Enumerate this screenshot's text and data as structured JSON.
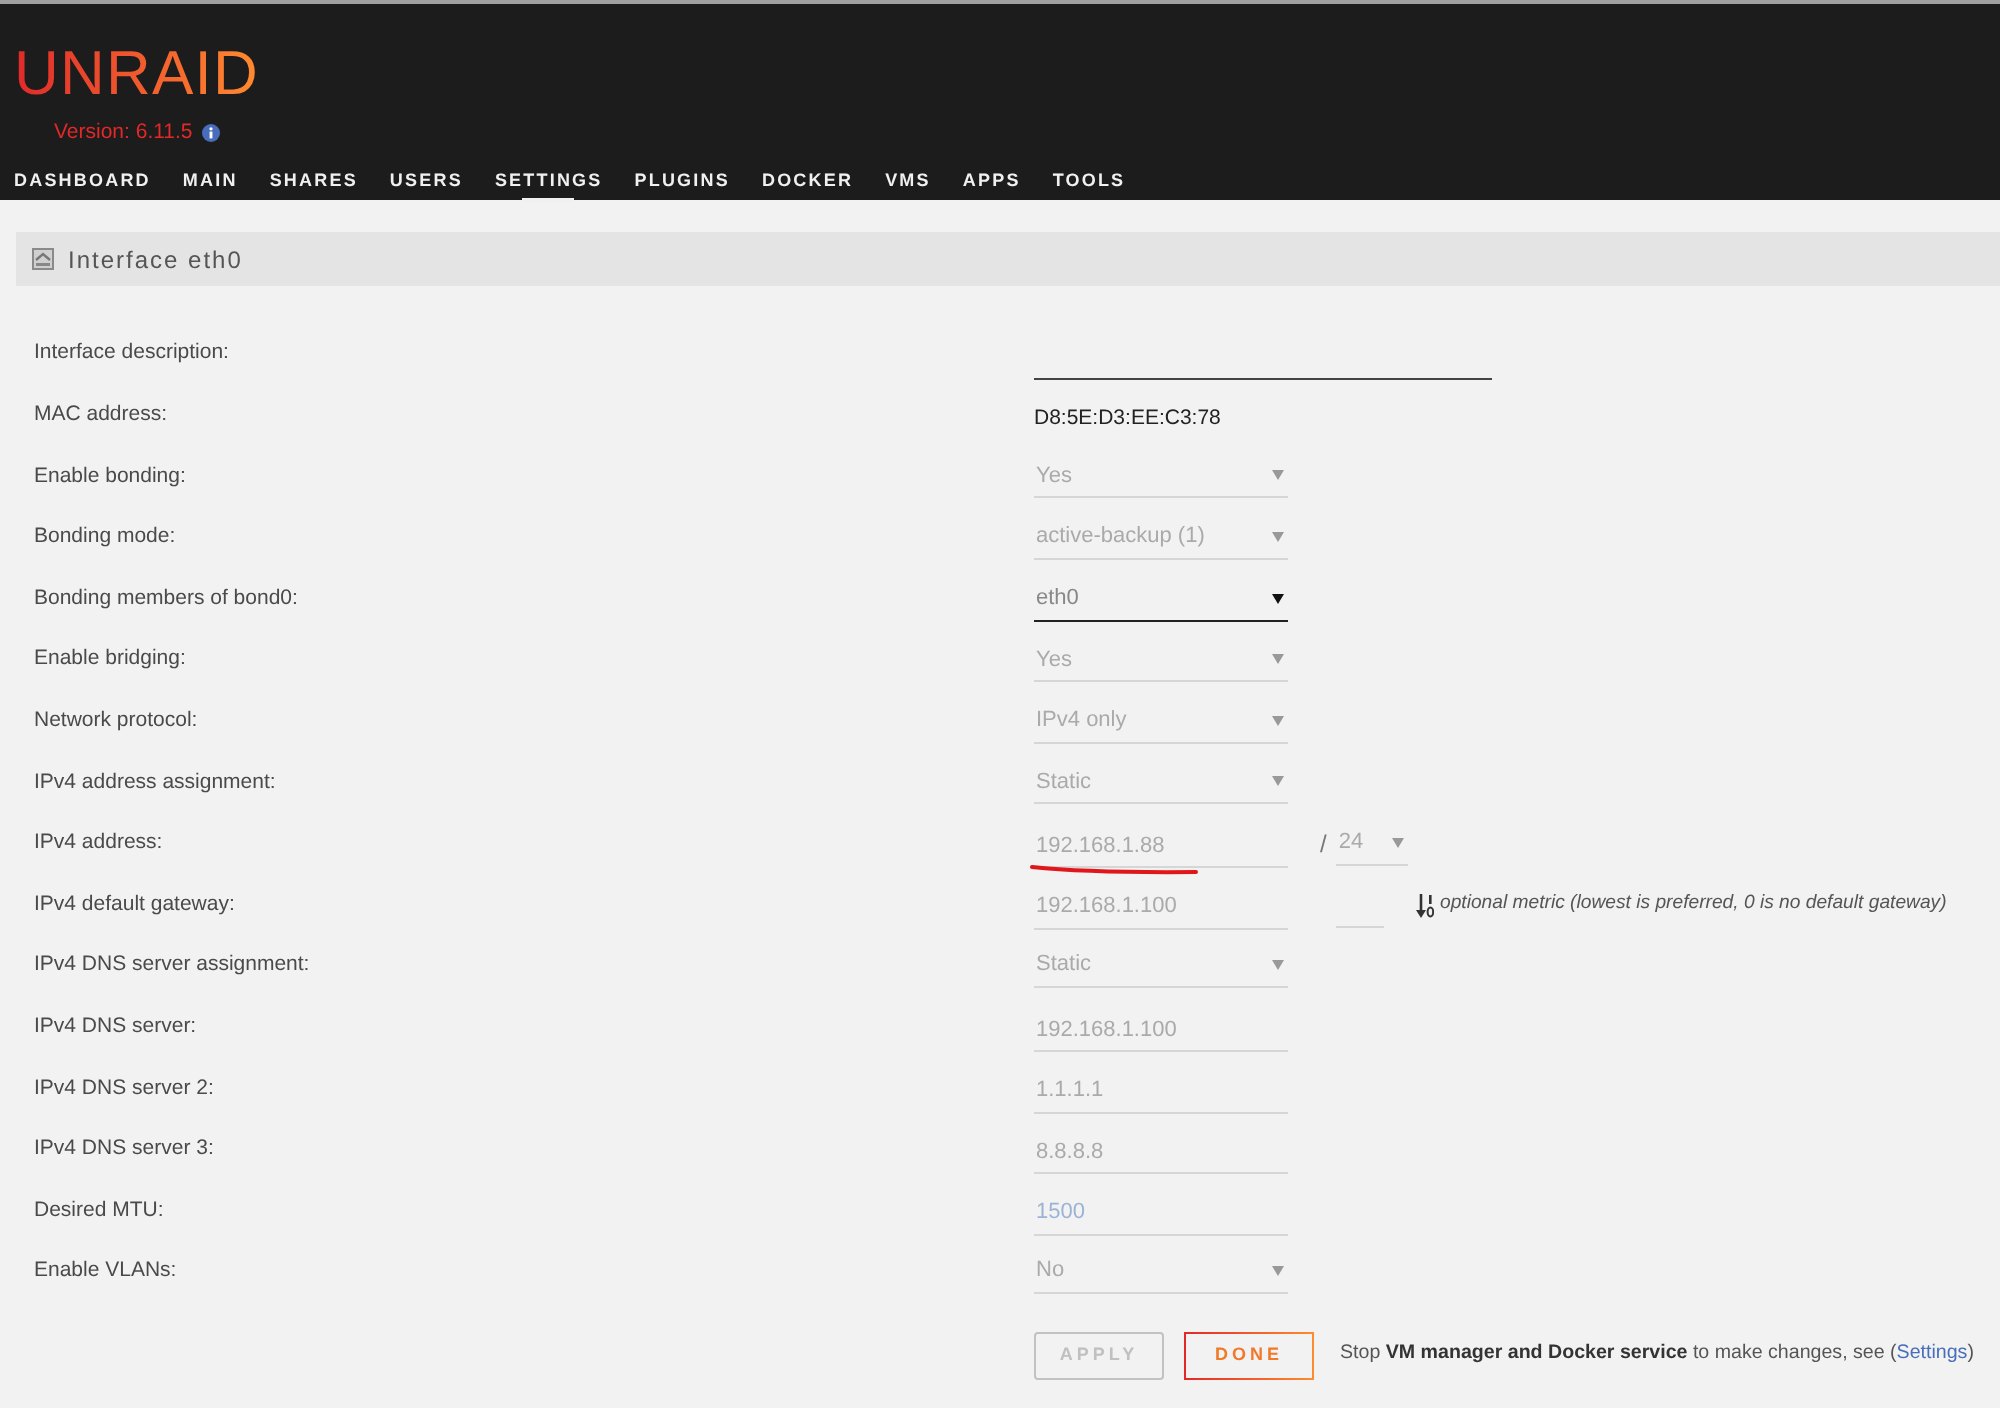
{
  "header": {
    "logo": "UNRAID",
    "version": "Version: 6.11.5",
    "nav": [
      {
        "label": "DASHBOARD",
        "selected": false
      },
      {
        "label": "MAIN",
        "selected": false
      },
      {
        "label": "SHARES",
        "selected": false
      },
      {
        "label": "USERS",
        "selected": false
      },
      {
        "label": "SETTINGS",
        "selected": true
      },
      {
        "label": "PLUGINS",
        "selected": false
      },
      {
        "label": "DOCKER",
        "selected": false
      },
      {
        "label": "VMS",
        "selected": false
      },
      {
        "label": "APPS",
        "selected": false
      },
      {
        "label": "TOOLS",
        "selected": false
      }
    ]
  },
  "panel": {
    "title": "Interface eth0"
  },
  "fields": [
    {
      "label": "Interface description:",
      "kind": "textline",
      "disabled": false
    },
    {
      "label": "MAC address:",
      "kind": "static",
      "value": "D8:5E:D3:EE:C3:78"
    },
    {
      "label": "Enable bonding:",
      "kind": "select",
      "value": "Yes",
      "disabled": true
    },
    {
      "label": "Bonding mode:",
      "kind": "select",
      "value": "active-backup (1)",
      "disabled": true
    },
    {
      "label": "Bonding members of bond0:",
      "kind": "select",
      "value": "eth0",
      "disabled": false
    },
    {
      "label": "Enable bridging:",
      "kind": "select",
      "value": "Yes",
      "disabled": true
    },
    {
      "label": "Network protocol:",
      "kind": "select",
      "value": "IPv4 only",
      "disabled": true
    },
    {
      "label": "IPv4 address assignment:",
      "kind": "select",
      "value": "Static",
      "disabled": true
    },
    {
      "label": "IPv4 address:",
      "kind": "input",
      "value": "192.168.1.88",
      "disabled": true,
      "marked": true,
      "suffix": {
        "separator": "/",
        "value": "24",
        "disabled": true
      }
    },
    {
      "label": "IPv4 default gateway:",
      "kind": "input",
      "value": "192.168.1.100",
      "disabled": true,
      "metric": {
        "disabled": true,
        "note": "optional metric (lowest is preferred, 0 is no default gateway)"
      }
    },
    {
      "label": "IPv4 DNS server assignment:",
      "kind": "select",
      "value": "Static",
      "disabled": true
    },
    {
      "label": "IPv4 DNS server:",
      "kind": "input",
      "value": "192.168.1.100",
      "disabled": true
    },
    {
      "label": "IPv4 DNS server 2:",
      "kind": "input",
      "value": "1.1.1.1",
      "disabled": true
    },
    {
      "label": "IPv4 DNS server 3:",
      "kind": "input",
      "value": "8.8.8.8",
      "disabled": true
    },
    {
      "label": "Desired MTU:",
      "kind": "input",
      "placeholder": "1500",
      "disabled": true
    },
    {
      "label": "Enable VLANs:",
      "kind": "select",
      "value": "No",
      "disabled": true
    }
  ],
  "buttons": [
    {
      "label": "APPLY",
      "disabled": true
    },
    {
      "label": "DONE",
      "disabled": false
    }
  ],
  "notice": {
    "text": "Stop **VM manager and Docker service** to make changes, see (",
    "link": "Settings",
    "end": ")"
  }
}
